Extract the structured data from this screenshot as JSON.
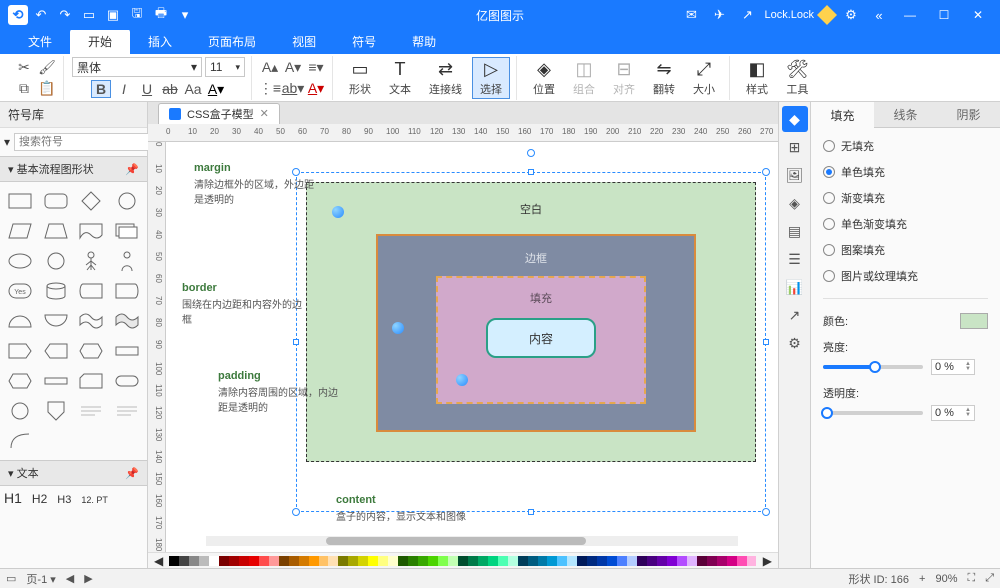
{
  "titlebar": {
    "app": "亿图图示",
    "lock": "Lock.Lock"
  },
  "menu": [
    "文件",
    "开始",
    "插入",
    "页面布局",
    "视图",
    "符号",
    "帮助"
  ],
  "ribbon": {
    "font": "黑体",
    "size": "11",
    "groups": {
      "shape": "形状",
      "text": "文本",
      "connector": "连接线",
      "select": "选择",
      "position": "位置",
      "combine": "组合",
      "align": "对齐",
      "flip": "翻转",
      "size2": "大小",
      "style": "样式",
      "tools": "工具"
    }
  },
  "left": {
    "title": "符号库",
    "search_ph": "搜索符号",
    "sect_shapes": "基本流程图形状",
    "sect_text": "文本",
    "h1": "H1",
    "h2": "H2",
    "h3": "H3",
    "pt": "12. PT"
  },
  "doc": {
    "tab": "CSS盒子模型"
  },
  "diagram": {
    "margin_t": "margin",
    "margin_d": "清除边框外的区域，外边距是透明的",
    "border_t": "border",
    "border_d": "围绕在内边距和内容外的边框",
    "padding_t": "padding",
    "padding_d": "清除内容周围的区域，内边距是透明的",
    "content_t": "content",
    "content_d": "盒子的内容，显示文本和图像",
    "lbl_blank": "空白",
    "lbl_border": "边框",
    "lbl_padding": "填充",
    "lbl_content": "内容"
  },
  "right": {
    "tabs": [
      "填充",
      "线条",
      "阴影"
    ],
    "opts": [
      "无填充",
      "单色填充",
      "渐变填充",
      "单色渐变填充",
      "图案填充",
      "图片或纹理填充"
    ],
    "color": "颜色:",
    "bright": "亮度:",
    "opacity": "透明度:",
    "bright_val": "0 %",
    "opacity_val": "0 %"
  },
  "status": {
    "page_lbl": "页-1",
    "shape_id": "形状 ID:",
    "shape_val": "166",
    "zoom": "90%",
    "plus": "+"
  }
}
